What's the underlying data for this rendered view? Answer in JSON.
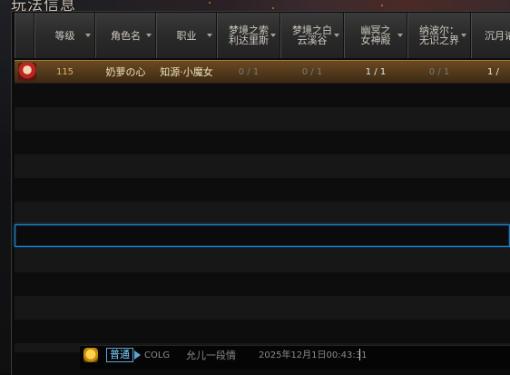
{
  "window": {
    "title": "玩法信息"
  },
  "table": {
    "columns": [
      {
        "label": "等级",
        "sortable": true
      },
      {
        "label": "角色名",
        "sortable": true
      },
      {
        "label": "职业",
        "sortable": true
      },
      {
        "label": "梦境之索利达里斯",
        "sortable": true
      },
      {
        "label": "梦境之白云溪谷",
        "sortable": true
      },
      {
        "label": "幽冥之女神殿",
        "sortable": true
      },
      {
        "label": "纳波尔：无识之界",
        "sortable": true
      },
      {
        "label": "沉月诸",
        "sortable": false
      }
    ],
    "rows": [
      {
        "level": "115",
        "name": "奶萝の心",
        "job": "知源·小魔女",
        "p1": "0 / 1",
        "p2": "0 / 1",
        "p3": "1 / 1",
        "p4": "0 / 1",
        "p5": "1 /"
      }
    ]
  },
  "chat": {
    "channel": "普通",
    "user": "COLG",
    "message": "允儿一段情",
    "timestamp": "2025年12月1日00:43:31"
  },
  "colors": {
    "header_text": "#cfc9bf",
    "selected_row": "#6b4a22",
    "focus_border": "#1e7ab8",
    "chat_channel": "#7ed0ff"
  }
}
